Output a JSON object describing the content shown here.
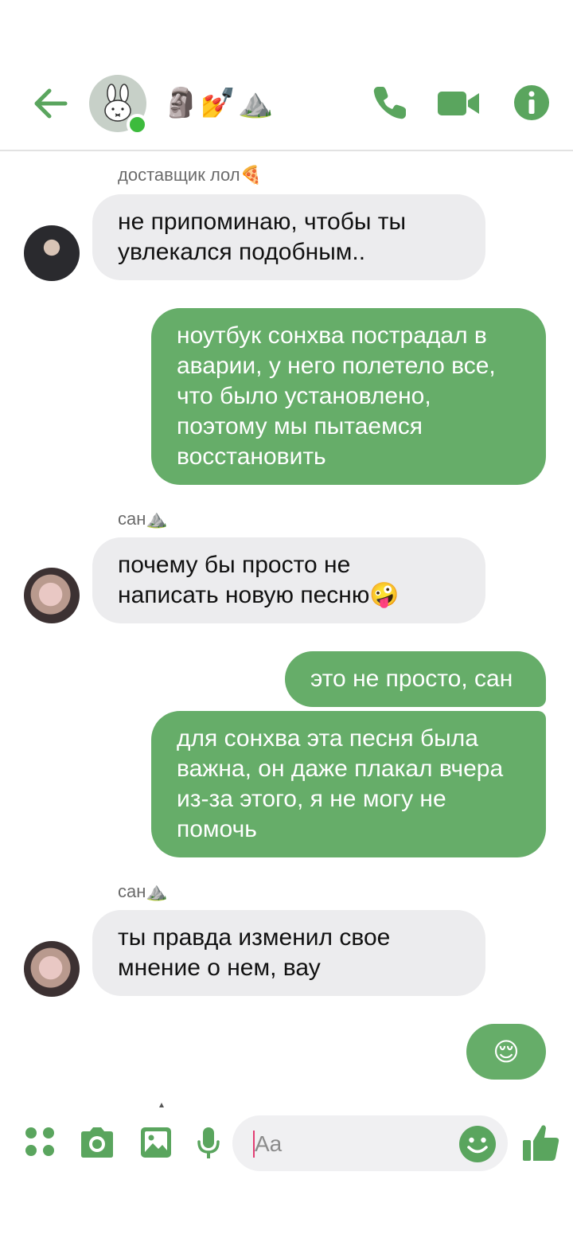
{
  "header": {
    "title": "🗿💅⛰️",
    "avatar": "bunny-avatar",
    "online": true,
    "icons": [
      "back-arrow-icon",
      "phone-icon",
      "video-camera-icon",
      "info-icon"
    ],
    "accent_color": "#5aa55e"
  },
  "messages": [
    {
      "type": "in",
      "sender": "доставщик лол🍕",
      "text": "не припоминаю, чтобы ты увлекался подобным.."
    },
    {
      "type": "out",
      "text": "ноутбук сонхва пострадал в аварии, у него полетело все, что было установлено, поэтому мы пытаемся восстановить"
    },
    {
      "type": "in",
      "sender": "сан⛰️",
      "text": "почему бы просто не написать новую песню🤪"
    },
    {
      "type": "out",
      "text": "это не просто, сан"
    },
    {
      "type": "out",
      "text": "для сонхва эта песня была важна, он даже плакал вчера из-за этого, я не могу не помочь"
    },
    {
      "type": "in",
      "sender": "сан⛰️",
      "text": "ты правда изменил свое мнение о нем, вау"
    },
    {
      "type": "out",
      "text": "😌"
    }
  ],
  "composer": {
    "placeholder": "Aa",
    "icons": [
      "apps-icon",
      "camera-icon",
      "image-icon",
      "microphone-icon",
      "emoji-icon",
      "thumbs-up-icon"
    ]
  }
}
